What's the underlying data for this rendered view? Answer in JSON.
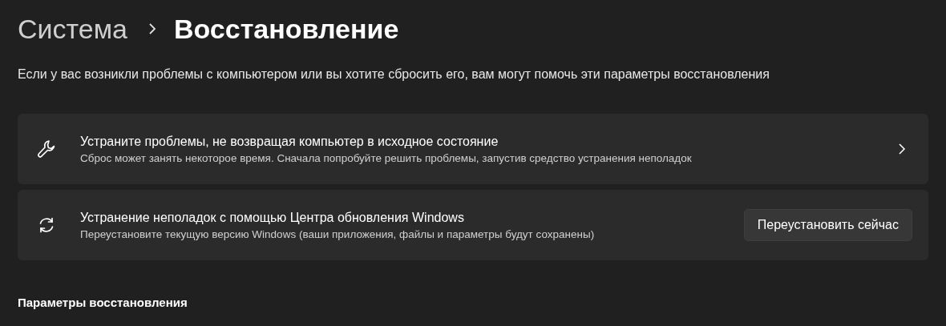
{
  "breadcrumb": [
    {
      "label": "Система",
      "current": false
    },
    {
      "label": "Восстановление",
      "current": true
    }
  ],
  "description": "Если у вас возникли проблемы с компьютером или вы хотите сбросить его, вам могут помочь эти параметры восстановления",
  "cards": [
    {
      "kind": "chevron",
      "title": "Устраните проблемы, не возвращая компьютер в исходное состояние",
      "subtitle": "Сброс может занять некоторое время. Сначала попробуйте решить проблемы, запустив средство устранения неполадок"
    },
    {
      "kind": "button",
      "title": "Устранение неполадок с помощью Центра обновления Windows",
      "subtitle": "Переустановите текущую версию Windows (ваши приложения, файлы и параметры будут сохранены)",
      "button": "Переустановить сейчас"
    }
  ],
  "section_heading": "Параметры восстановления"
}
